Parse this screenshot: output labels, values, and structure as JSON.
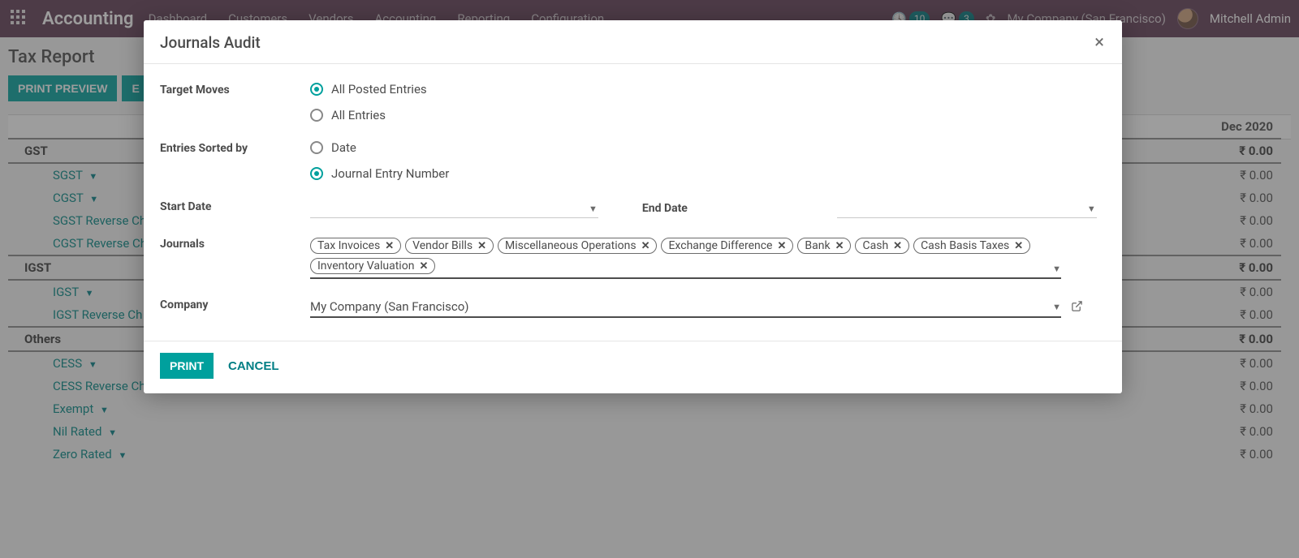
{
  "navbar": {
    "brand": "Accounting",
    "menu": [
      "Dashboard",
      "Customers",
      "Vendors",
      "Accounting",
      "Reporting",
      "Configuration"
    ],
    "badge1": "10",
    "badge2": "3",
    "company": "My Company (San Francisco)",
    "user": "Mitchell Admin"
  },
  "page": {
    "breadcrumb": "Tax Report",
    "buttons": {
      "print_preview": "PRINT PREVIEW",
      "export_first": "E"
    },
    "period": "Dec 2020",
    "rows": [
      {
        "type": "group",
        "label": "GST",
        "value": "₹ 0.00",
        "indent": 1
      },
      {
        "type": "sub",
        "label": "SGST",
        "value": "₹ 0.00"
      },
      {
        "type": "sub",
        "label": "CGST",
        "value": "₹ 0.00"
      },
      {
        "type": "sub",
        "label": "SGST Reverse Ch",
        "value": "₹ 0.00"
      },
      {
        "type": "sub",
        "label": "CGST Reverse Ch",
        "value": "₹ 0.00"
      },
      {
        "type": "group",
        "label": "IGST",
        "value": "₹ 0.00",
        "indent": 1
      },
      {
        "type": "sub",
        "label": "IGST",
        "value": "₹ 0.00"
      },
      {
        "type": "sub",
        "label": "IGST Reverse Ch",
        "value": "₹ 0.00"
      },
      {
        "type": "group",
        "label": "Others",
        "value": "₹ 0.00",
        "indent": 1
      },
      {
        "type": "sub",
        "label": "CESS",
        "value": "₹ 0.00"
      },
      {
        "type": "sub",
        "label": "CESS Reverse Ch",
        "value": "₹ 0.00"
      },
      {
        "type": "sub",
        "label": "Exempt",
        "value": "₹ 0.00"
      },
      {
        "type": "sub",
        "label": "Nil Rated",
        "value": "₹ 0.00"
      },
      {
        "type": "sub",
        "label": "Zero Rated",
        "value": "₹ 0.00"
      }
    ]
  },
  "modal": {
    "title": "Journals Audit",
    "labels": {
      "target_moves": "Target Moves",
      "entries_sorted_by": "Entries Sorted by",
      "start_date": "Start Date",
      "end_date": "End Date",
      "journals": "Journals",
      "company": "Company"
    },
    "target_moves": {
      "selected": "posted",
      "options": {
        "posted": "All Posted Entries",
        "all": "All Entries"
      }
    },
    "sort_by": {
      "selected": "number",
      "options": {
        "date": "Date",
        "number": "Journal Entry Number"
      }
    },
    "start_date": "",
    "end_date": "",
    "journals": [
      "Tax Invoices",
      "Vendor Bills",
      "Miscellaneous Operations",
      "Exchange Difference",
      "Bank",
      "Cash",
      "Cash Basis Taxes",
      "Inventory Valuation"
    ],
    "company": "My Company (San Francisco)",
    "buttons": {
      "print": "PRINT",
      "cancel": "CANCEL"
    }
  }
}
